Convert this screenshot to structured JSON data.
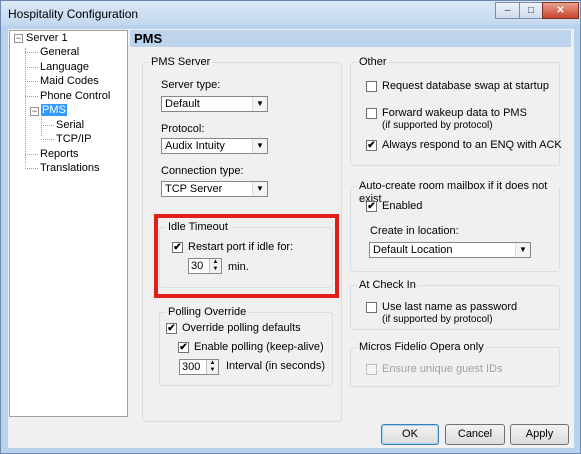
{
  "window": {
    "title": "Hospitality Configuration",
    "caption_buttons": {
      "minimize": "–",
      "maximize": "□",
      "close": "✕"
    }
  },
  "tree": {
    "root": "Server 1",
    "items": [
      "General",
      "Language",
      "Maid Codes",
      "Phone Control",
      "PMS",
      "Serial",
      "TCP/IP",
      "Reports",
      "Translations"
    ],
    "selected": "PMS"
  },
  "page": {
    "title": "PMS"
  },
  "pms_server": {
    "group_title": "PMS Server",
    "server_type_label": "Server type:",
    "server_type_value": "Default",
    "protocol_label": "Protocol:",
    "protocol_value": "Audix Intuity",
    "connection_type_label": "Connection type:",
    "connection_type_value": "TCP Server"
  },
  "idle_timeout": {
    "group_title": "Idle Timeout",
    "restart_label": "Restart port if idle for:",
    "restart_checked": true,
    "minutes_value": "30",
    "minutes_unit": "min."
  },
  "polling": {
    "group_title": "Polling Override",
    "override_label": "Override polling defaults",
    "override_checked": true,
    "enable_label": "Enable polling (keep-alive)",
    "enable_checked": true,
    "interval_value": "300",
    "interval_label": "Interval (in seconds)"
  },
  "other": {
    "group_title": "Other",
    "request_swap_label": "Request database swap at startup",
    "request_swap_checked": false,
    "forward_wakeup_label": "Forward wakeup data to PMS",
    "forward_wakeup_sub": "(if supported by protocol)",
    "forward_wakeup_checked": false,
    "enq_label": "Always respond to an ENQ with ACK",
    "enq_checked": true
  },
  "auto_create": {
    "group_title": "Auto-create room mailbox if it does not exist",
    "enabled_label": "Enabled",
    "enabled_checked": true,
    "location_label": "Create in location:",
    "location_value": "Default Location"
  },
  "check_in": {
    "group_title": "At Check In",
    "last_name_label": "Use last name as password",
    "last_name_sub": "(if supported by protocol)",
    "last_name_checked": false
  },
  "fidelio": {
    "group_title": "Micros Fidelio Opera only",
    "unique_ids_label": "Ensure unique guest IDs",
    "unique_ids_checked": false
  },
  "buttons": {
    "ok": "OK",
    "cancel": "Cancel",
    "apply": "Apply"
  },
  "glyphs": {
    "check": "✔",
    "dropdown": "▼",
    "spin_up": "▲",
    "spin_down": "▼",
    "collapse": "−"
  },
  "colors": {
    "selection": "#3399ff",
    "highlight_box": "#e0201b",
    "header_band": "#bdd4ec"
  }
}
